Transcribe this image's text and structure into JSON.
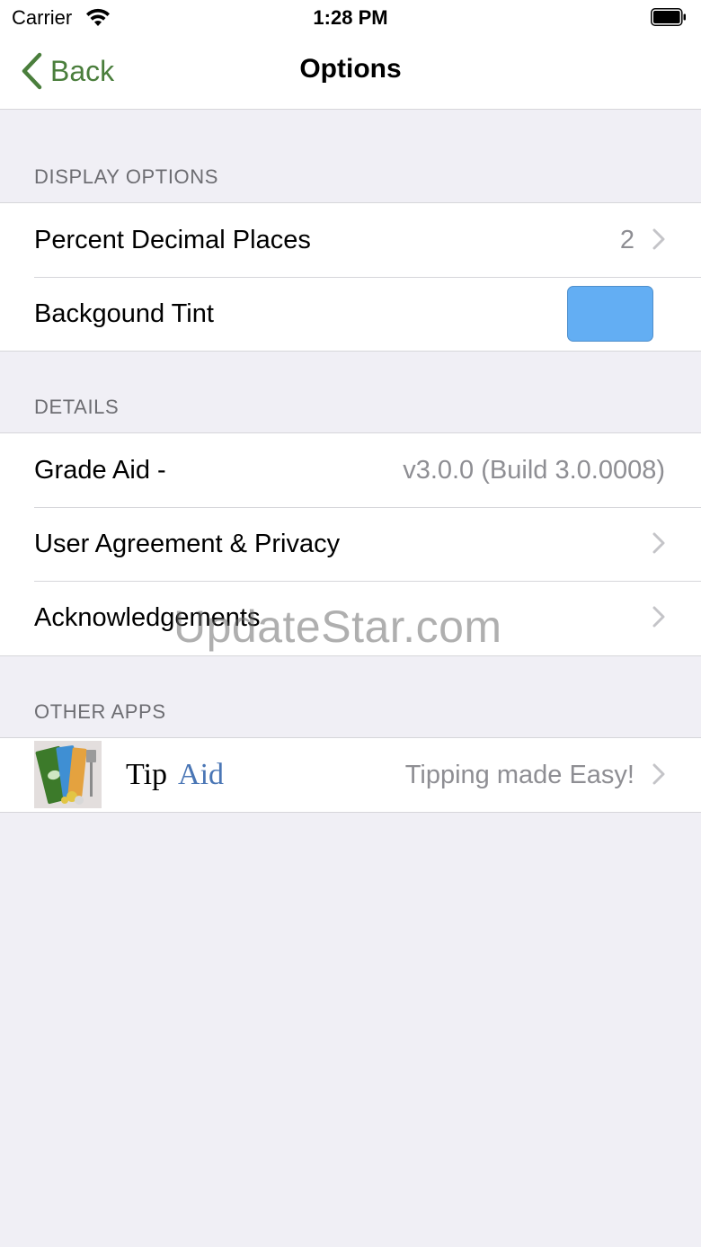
{
  "status_bar": {
    "carrier": "Carrier",
    "time": "1:28 PM"
  },
  "nav": {
    "back_label": "Back",
    "title": "Options",
    "accent_color": "#4a7e3c"
  },
  "sections": {
    "display": {
      "header": "DISPLAY OPTIONS",
      "percent_label": "Percent Decimal Places",
      "percent_value": "2",
      "tint_label": "Backgound Tint",
      "tint_color": "#63aef3"
    },
    "details": {
      "header": "DETAILS",
      "app_label": "Grade Aid -",
      "app_version": "v3.0.0 (Build 3.0.0008)",
      "agreement_label": "User Agreement & Privacy",
      "ack_label": "Acknowledgements"
    },
    "other_apps": {
      "header": "OTHER APPS",
      "app_name_part1": "Tip",
      "app_name_part2": "Aid",
      "app_tagline": "Tipping made Easy!"
    }
  },
  "watermark": "UpdateStar.com"
}
